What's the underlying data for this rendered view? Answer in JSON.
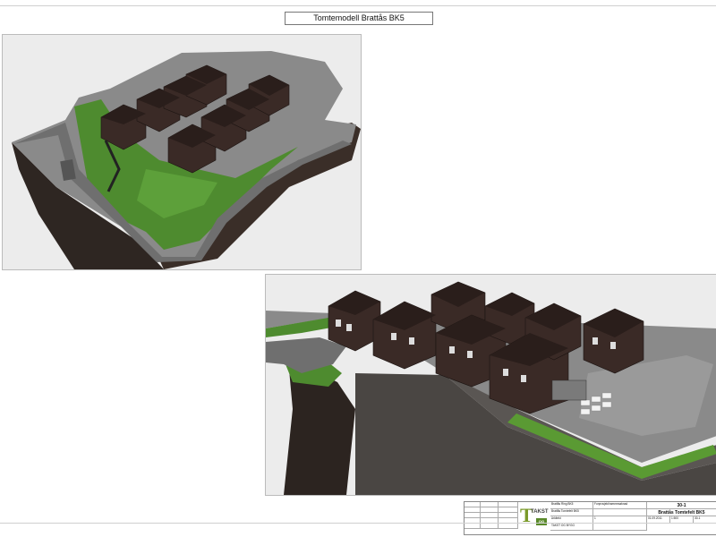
{
  "sheet": {
    "title": "Tomtemodell Brattås BK5"
  },
  "title_block": {
    "logo_letter": "T",
    "logo_text": "TAKST",
    "logo_box": "OG",
    "drawing_no": "30-1",
    "project_title": "Brattås Tomtefelt BK5",
    "project_short": "Brattås Tomtefelt BK5",
    "project_small": "Brattås Ring BK5",
    "phase": "Forprosjekt/rammesøknad",
    "revision_label": "Arkitekt",
    "drawing_code": "1",
    "date": "01.09.2011",
    "scale_label": "1:500",
    "sheet_label": "30-1",
    "company": "TAKST OG BYGG"
  }
}
